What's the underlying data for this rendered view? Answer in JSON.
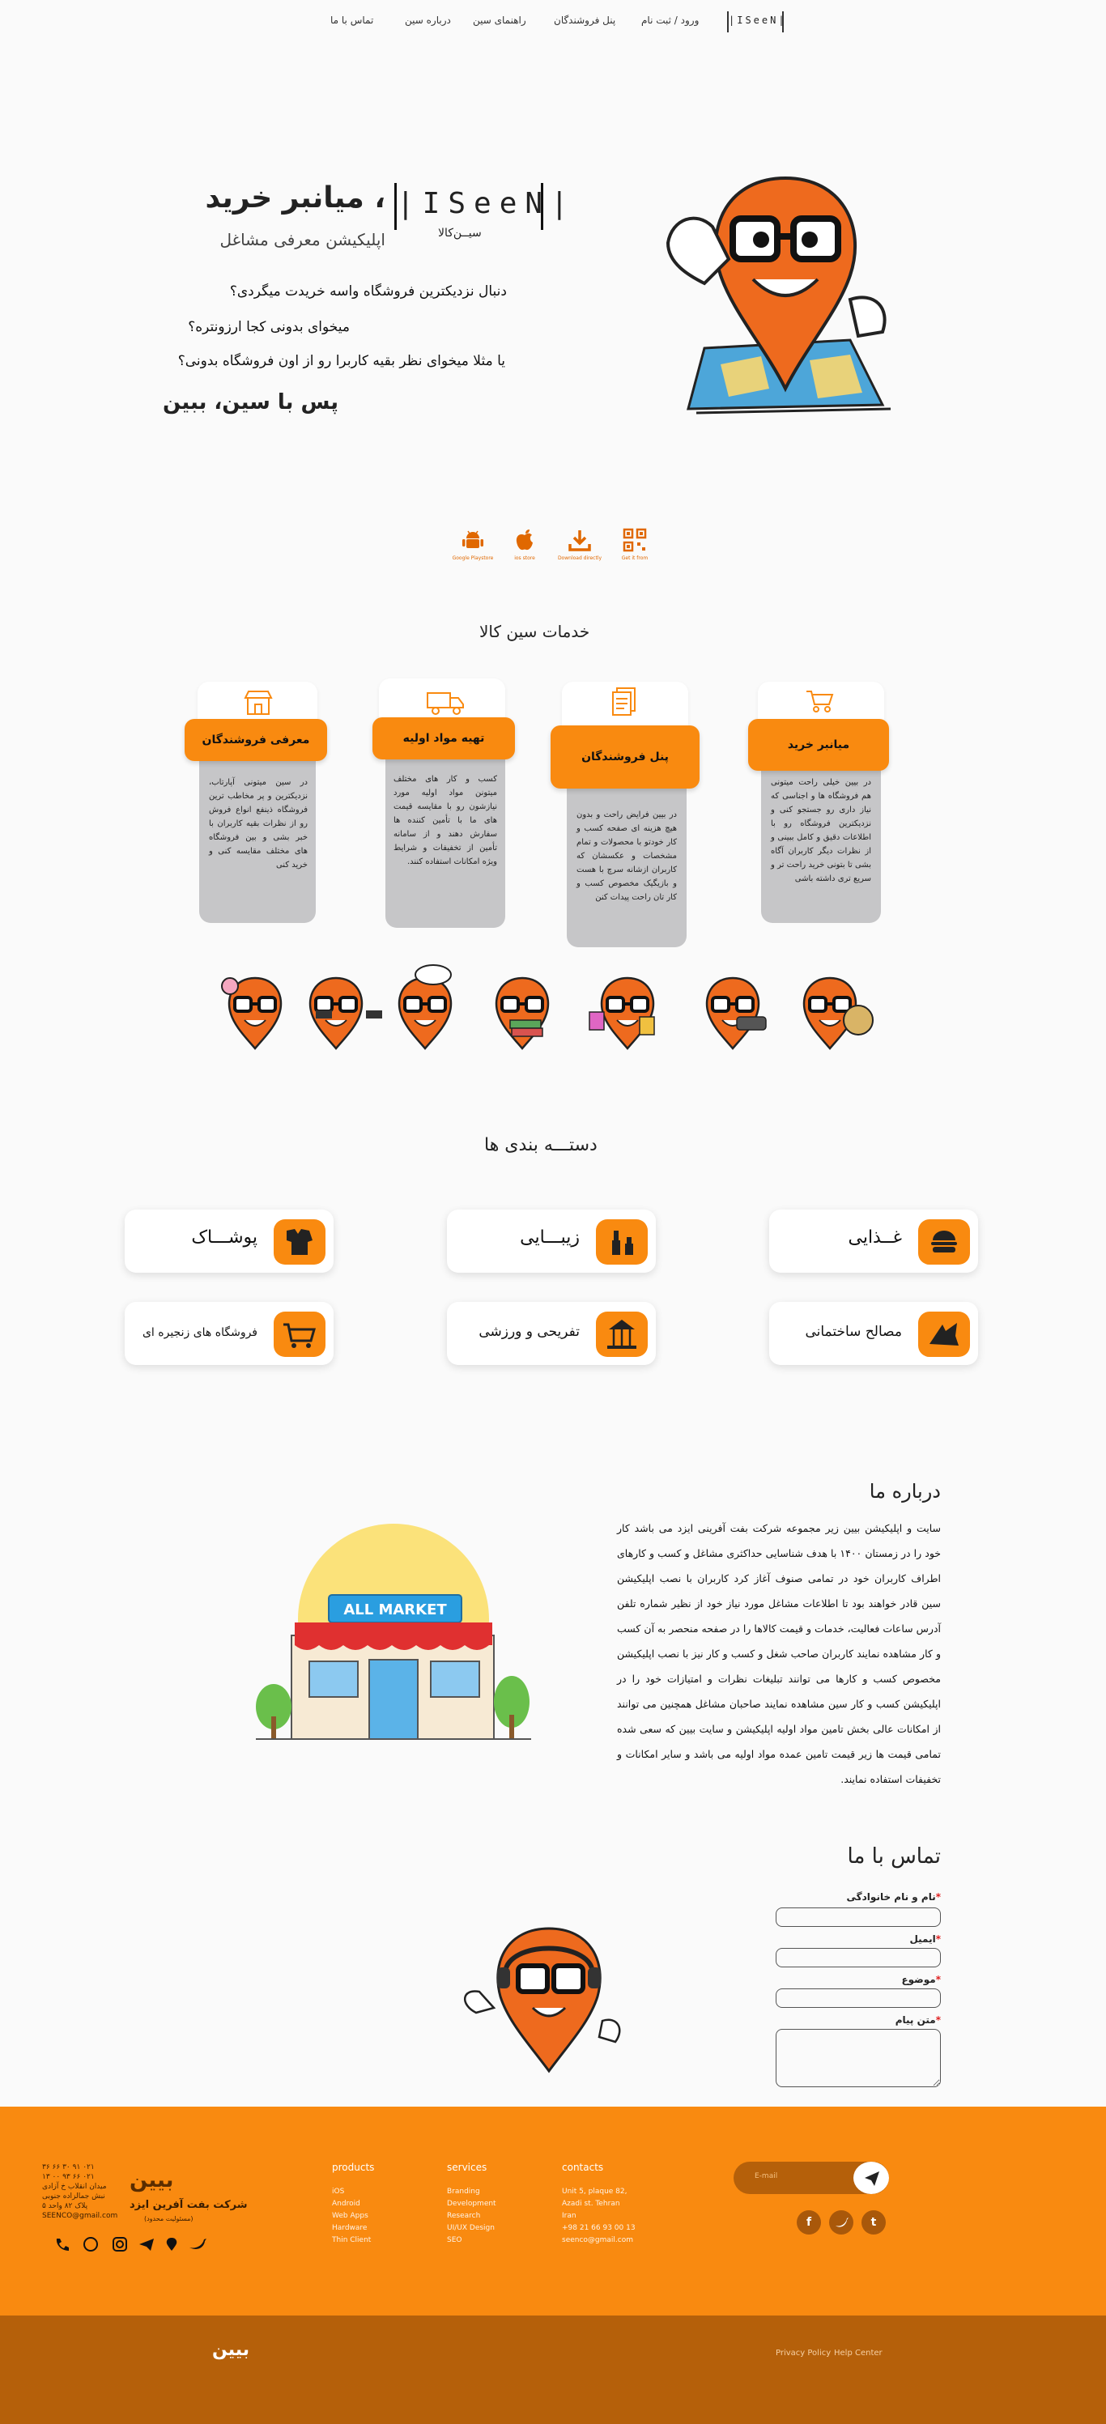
{
  "nav": {
    "logo": "|ISeeN|",
    "login": "ورود / ثبت نام",
    "sellers_panel": "پنل فروشندگان",
    "guide": "راهنمای سین",
    "about": "درباره سین",
    "contact": "تماس با ما"
  },
  "hero": {
    "title": "، میانبر خرید",
    "logo_text": "|ISeeN|",
    "logo_sub": "سیــن‌کالا",
    "subtitle": "اپلیکیشن معرفی مشاغل",
    "q1": "دنبال نزدیکترین فروشگاه واسه خریدت میگردی؟",
    "q2": "میخوای بدونی کجا ارزونتره؟",
    "q3": "یا مثلا میخوای نظر بقیه کاربرا رو از اون فروشگاه بدونی؟",
    "cta": "پس با سین، ببین"
  },
  "downloads": [
    {
      "label": "Get it from",
      "icon": "qr-code-icon"
    },
    {
      "label": "Download directly",
      "icon": "download-icon"
    },
    {
      "label": "ios store",
      "icon": "apple-icon"
    },
    {
      "label": "Google Playstore",
      "icon": "android-icon"
    }
  ],
  "services": {
    "title": "خدمات سین کالا",
    "items": [
      {
        "title": "معرفی فروشندگان",
        "icon": "shop-icon",
        "body": "در سین میتونی آپارتاب، نزدیکترین و پر مخاطب ترین فروشگاه ذینفع انواع فروش رو از نظرات بقیه کاربران با خبر بشی و بین فروشگاه های مختلف مقایسه کنی و خرید کنی"
      },
      {
        "title": "تهیه مواد اولیه",
        "icon": "truck-icon",
        "body": "کسب و کار های مختلف میتونن مواد اولیه مورد نیازشون رو با مقایسه قیمت های ما با تأمین کننده ها سفارش دهند و از سامانه تأمین از تخفیفات و شرایط ویژه امکانات استفاده کنند."
      },
      {
        "title": "پنل فروشندگان",
        "icon": "document-icon",
        "body": "در بیین فرایض راحت و بدون هیچ هزینه ای صفحه کسب و کار خودتو با محصولات و تمام مشخصات و عکسشان که کاربران ازشانه سرچ با هست و بازیگیک مخصوص کسب و کار تان راحت پیدات کنن"
      },
      {
        "title": "میانبر خرید",
        "icon": "cart-icon",
        "body": "در بیین خیلی راحت میتونی هم فروشگاه ها و اجناسی که نیاز داری رو جستجو کنی و نزدیکترین فروشگاه رو با اطلاعات دقیق و کامل ببینی و از نظرات دیگر کاربران آگاه بشی تا بتونی خرید راحت تر و سریع تری داشته باشی"
      }
    ]
  },
  "categories": {
    "title": "دستـــه بندی ها",
    "items": [
      {
        "label": "غــذایی",
        "icon": "burger-icon"
      },
      {
        "label": "زیبـــایی",
        "icon": "cosmetics-icon"
      },
      {
        "label": "پوشـــاک",
        "icon": "clothing-icon"
      },
      {
        "label": "مصالح ساختمانی",
        "icon": "building-materials-icon"
      },
      {
        "label": "تفریحی و ورزشی",
        "icon": "carousel-icon"
      },
      {
        "label": "فروشگاه های زنجیره ای",
        "icon": "shopping-cart-icon"
      }
    ]
  },
  "about": {
    "title": "درباره ما",
    "market_sign": "ALL MARKET",
    "body": "سایت و اپلیکیشن بیین زیر مجموعه شرکت بفت آفرینی ایزد می باشد کار خود را در زمستان ۱۴۰۰ با هدف شناسایی حداکثری مشاغل و کسب و کارهای اطراف کاربران خود در تمامی صنوف آغاز کرد کاربران با نصب اپلیکیشن سین قادر خواهند بود تا اطلاعات مشاغل مورد نیاز خود از نظیر شماره تلفن آدرس ساعات فعالیت، خدمات و قیمت کالاها را در صفحه منحصر به آن کسب و کار مشاهده نمایند کاربران صاحب شغل و کسب و کار نیز با نصب اپلیکیشن مخصوص کسب و کارها می توانند تبلیغات نظرات و امتیازات خود را در اپلیکیشن کسب و کار سین مشاهده نمایند صاحبان مشاغل همچنین می توانند از امکانات عالی بخش تامین مواد اولیه اپلیکیشن و سایت بیین که سعی شده تمامی قیمت ها زیر قیمت تامین عمده مواد اولیه می باشد و سایر امکانات و تخفیفات استفاده نمایند."
  },
  "contact": {
    "title": "تماس با ما",
    "name_label": "نام و نام خانوادگی",
    "email_label": "ایمیل",
    "subject_label": "موضوع",
    "message_label": "متن پیام"
  },
  "footer": {
    "company_line1": "شرکت بفت آفرین ایزد",
    "company_line2": "(مسئولیت محدود)",
    "company_logo": "بیین",
    "contact_lines": [
      "۰۲۱ ۹۱ ۳۰ ۶۶ ۳۶",
      "۰۲۱ ۶۶ ۹۳ ۰۰ ۱۳",
      "میدان انقلاب خ آزادی",
      "نبش جمالزاده جنوبی",
      "پلاک ۸۲ واحد ۵",
      "SEENCO@gmail.com"
    ],
    "products": {
      "title": "products",
      "items": [
        "iOS",
        "Android",
        "Web Apps",
        "Hardware",
        "Thin Client"
      ]
    },
    "services": {
      "title": "services",
      "items": [
        "Branding",
        "Development",
        "Research",
        "UI/UX Design",
        "SEO"
      ]
    },
    "contacts": {
      "title": "contacts",
      "items": [
        "Unit 5, plaque 82,",
        "Azadi st. Tehran",
        "Iran",
        "+98 21 66 93 00 13",
        "seenco@gmail.com"
      ]
    },
    "email_placeholder": "E-mail",
    "privacy": "Privacy Policy",
    "help": "Help Center",
    "bottom_logo": "بیین",
    "accent": "#f98a10",
    "dark": "#b5600a"
  }
}
